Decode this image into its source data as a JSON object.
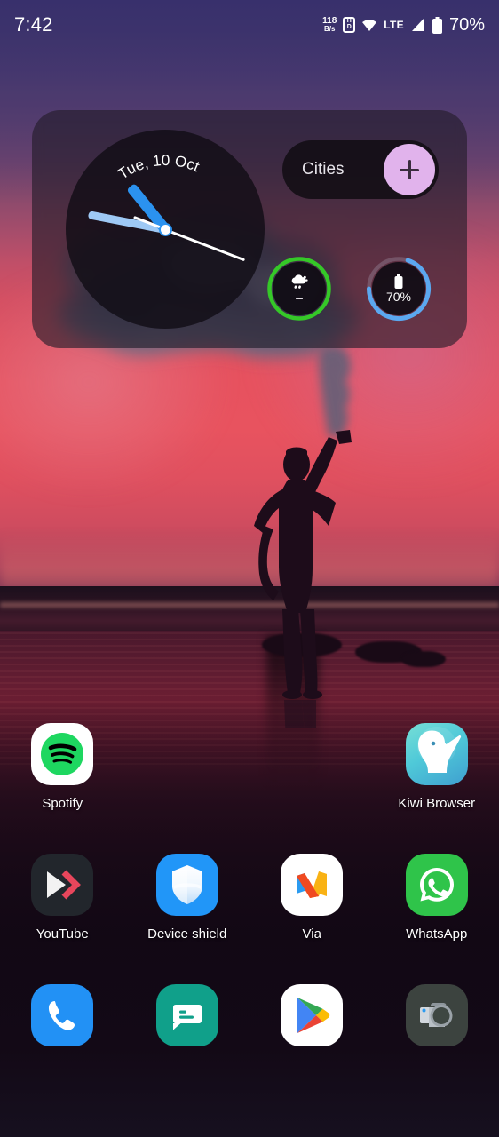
{
  "statusbar": {
    "time": "7:42",
    "net_speed_value": "118",
    "net_speed_unit": "B/s",
    "hd_icon": "hd-icon",
    "hd_top": "H",
    "hd_bottom": "D",
    "wifi_icon": "wifi-icon",
    "network_type": "LTE",
    "signal_icon": "signal-bars-icon",
    "battery_icon": "battery-icon",
    "battery_percent": "70%"
  },
  "widget": {
    "clock": {
      "name": "analog-clock",
      "date_label": "Tue, 10 Oct",
      "hour_hand_color": "#2b92ef",
      "minute_hand_color": "#9ec9f5",
      "second_hand_color": "#ffffff"
    },
    "cities": {
      "label": "Cities",
      "add_button_icon": "plus-icon",
      "add_button_color": "#e1b3ec"
    },
    "weather": {
      "icon": "cloud-rain-icon",
      "temperature": "–",
      "ring_color": "#35c828"
    },
    "battery": {
      "icon": "battery-icon",
      "percent": "70%",
      "ring_color": "#5ba8f0",
      "ring_fill": 70
    }
  },
  "apps": {
    "row1": [
      {
        "name": "spotify",
        "label": "Spotify",
        "icon": "spotify-icon"
      },
      {
        "name": "empty-1",
        "label": "",
        "icon": ""
      },
      {
        "name": "empty-2",
        "label": "",
        "icon": ""
      },
      {
        "name": "kiwi-browser",
        "label": "Kiwi Browser",
        "icon": "kiwi-icon"
      }
    ],
    "row2": [
      {
        "name": "youtube",
        "label": "YouTube",
        "icon": "youtube-icon"
      },
      {
        "name": "device-shield",
        "label": "Device shield",
        "icon": "shield-icon"
      },
      {
        "name": "via",
        "label": "Via",
        "icon": "via-icon"
      },
      {
        "name": "whatsapp",
        "label": "WhatsApp",
        "icon": "whatsapp-icon"
      }
    ],
    "dock": [
      {
        "name": "phone",
        "label": "",
        "icon": "phone-icon"
      },
      {
        "name": "messages",
        "label": "",
        "icon": "message-icon"
      },
      {
        "name": "play-store",
        "label": "",
        "icon": "play-store-icon"
      },
      {
        "name": "camera",
        "label": "",
        "icon": "camera-icon"
      }
    ]
  },
  "wallpaper": {
    "description": "sunset-beach-silhouette",
    "sky_top_color": "#3b3266",
    "sky_mid_color": "#e8535f",
    "sand_color": "#6d1e33"
  }
}
